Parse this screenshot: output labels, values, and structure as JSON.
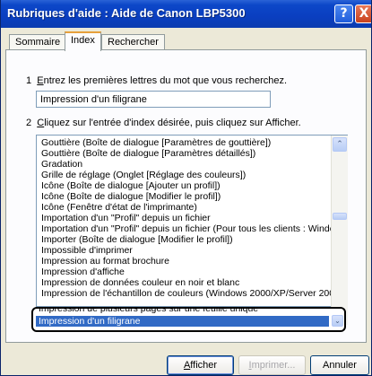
{
  "window": {
    "title": "Rubriques d'aide : Aide de Canon LBP5300",
    "help_glyph": "?",
    "close_glyph": "X"
  },
  "tabs": [
    {
      "label": "Sommaire",
      "active": false
    },
    {
      "label": "Index",
      "active": true
    },
    {
      "label": "Rechercher",
      "active": false
    }
  ],
  "step1": {
    "number": "1",
    "accel": "E",
    "text_rest": "ntrez les premières lettres du mot que vous recherchez."
  },
  "search": {
    "value": "Impression d'un filigrane"
  },
  "step2": {
    "number": "2",
    "accel": "C",
    "text_rest": "liquez sur l'entrée d'index désirée, puis cliquez sur Afficher."
  },
  "index_list": {
    "items": [
      "Gouttière (Boîte de dialogue [Paramètres de gouttière])",
      "Gouttière (Boîte de dialogue [Paramètres détaillés])",
      "Gradation",
      "Grille de réglage (Onglet [Réglage des couleurs])",
      "Icône (Boîte de dialogue [Ajouter un profil])",
      "Icône (Boîte de dialogue [Modifier le profil])",
      "Icône (Fenêtre d'état de l'imprimante)",
      "Importation d'un \"Profil\" depuis un fichier",
      "Importation d'un \"Profil\" depuis un fichier (Pour tous les clients : Window",
      "Importer (Boîte de dialogue [Modifier le profil])",
      "Impossible d'imprimer",
      "Impression au format brochure",
      "Impression d'affiche",
      "Impression de données couleur en noir et blanc",
      "Impression de l'échantillon de couleurs (Windows 2000/XP/Server 200:"
    ],
    "partial_item": "Impression de plusieurs pages sur une feuille unique",
    "selected_item": "Impression d'un filigrane",
    "scroll_up_glyph": "⌃",
    "scroll_down_glyph": "⌄"
  },
  "buttons": {
    "afficher_accel": "A",
    "afficher_rest": "fficher",
    "imprimer_accel": "I",
    "imprimer_rest": "mprimer...",
    "annuler": "Annuler"
  },
  "colors": {
    "titlebar": "#0a3ec0",
    "selection": "#316ac5",
    "tab_accent": "#e6a03c"
  }
}
